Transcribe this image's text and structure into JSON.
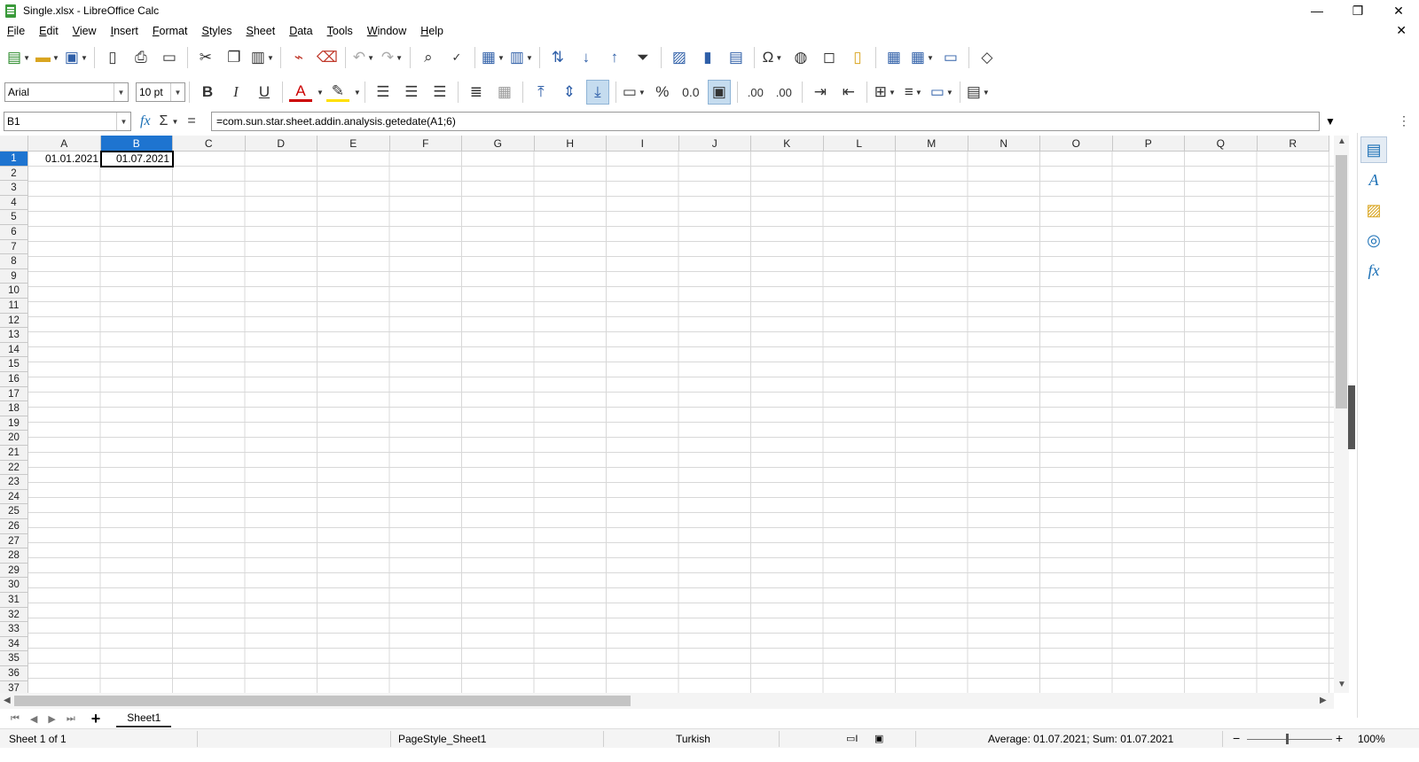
{
  "window": {
    "title": "Single.xlsx - LibreOffice Calc",
    "minimize": "—",
    "maximize": "❐",
    "close": "✕",
    "doc_close": "✕"
  },
  "menu": [
    "File",
    "Edit",
    "View",
    "Insert",
    "Format",
    "Styles",
    "Sheet",
    "Data",
    "Tools",
    "Window",
    "Help"
  ],
  "toolbar2": {
    "font_name": "Arial",
    "font_size": "10 pt",
    "bold": "B",
    "italic": "I",
    "underline": "U",
    "percent": "%",
    "number": "0.0",
    "add_decimal": ".00",
    "del_decimal": ".00"
  },
  "formula": {
    "cell_ref": "B1",
    "content": "=com.sun.star.sheet.addin.analysis.getedate(A1;6)"
  },
  "grid": {
    "columns": [
      "A",
      "B",
      "C",
      "D",
      "E",
      "F",
      "G",
      "H",
      "I",
      "J",
      "K",
      "L",
      "M",
      "N",
      "O",
      "P",
      "Q",
      "R"
    ],
    "selected_column": "B",
    "selected_row": "1",
    "rows": [
      "1",
      "2",
      "3",
      "4",
      "5",
      "6",
      "7",
      "8",
      "9",
      "10",
      "11",
      "12",
      "13",
      "14",
      "15",
      "16",
      "17",
      "18",
      "19",
      "20",
      "21",
      "22",
      "23",
      "24",
      "25",
      "26",
      "27",
      "28",
      "29",
      "30",
      "31",
      "32",
      "33",
      "34",
      "35",
      "36",
      "37"
    ],
    "cells": {
      "A1": "01.01.2021",
      "B1": "01.07.2021"
    }
  },
  "sheet_tabs": {
    "add": "+",
    "tabs": [
      "Sheet1"
    ]
  },
  "status": {
    "sheet": "Sheet 1 of 1",
    "page_style": "PageStyle_Sheet1",
    "language": "Turkish",
    "summary": "Average: 01.07.2021; Sum: 01.07.2021",
    "zoom": "100%",
    "zoom_minus": "−",
    "zoom_plus": "+"
  }
}
